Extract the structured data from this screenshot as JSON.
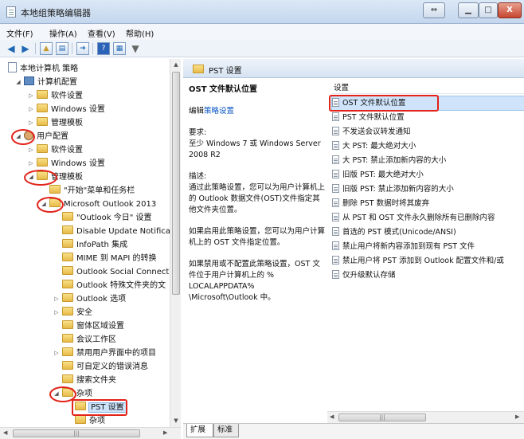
{
  "window": {
    "title": "本地组策略编辑器",
    "controls": {
      "restore": "⇔",
      "minimize": "▁",
      "maximize": "□",
      "close": "X"
    }
  },
  "menu": {
    "items": [
      "文件(F)",
      "操作(A)",
      "查看(V)",
      "帮助(H)"
    ]
  },
  "toolbar": {
    "buttons": [
      "back-icon",
      "forward-icon",
      "folder-up-icon",
      "show-hide-tree-icon",
      "export-icon",
      "help-icon",
      "view-icon",
      "filter-icon"
    ]
  },
  "tree": {
    "root": "本地计算机 策略",
    "computer_config": "计算机配置",
    "software_settings_1": "软件设置",
    "windows_settings_1": "Windows 设置",
    "admin_templates_1": "管理模板",
    "user_config": "用户配置",
    "software_settings_2": "软件设置",
    "windows_settings_2": "Windows 设置",
    "admin_templates_2": "管理模板",
    "start_menu": "\"开始\"菜单和任务栏",
    "outlook_2013": "Microsoft Outlook 2013",
    "outlook_today": "\"Outlook 今日\" 设置",
    "disable_update": "Disable Update Notifica",
    "infopath": "InfoPath 集成",
    "mime": "MIME 到 MAPI 的转换",
    "social_connect": "Outlook Social Connect",
    "special_folders": "Outlook 特殊文件夹的文",
    "outlook_options": "Outlook 选项",
    "security": "安全",
    "form_regions": "窗体区域设置",
    "meeting_workspace": "会议工作区",
    "disable_ui": "禁用用户界面中的项目",
    "custom_errors": "可自定义的错误消息",
    "search_folders": "搜索文件夹",
    "misc": "杂项",
    "pst_settings": "PST 设置",
    "misc_sub": "杂项"
  },
  "right": {
    "header": "PST 设置",
    "desc": {
      "title": "OST 文件默认位置",
      "edit_prefix": "编辑",
      "edit_link": "策略设置",
      "req_label": "要求:",
      "req_text": "至少 Windows 7 或 Windows Server 2008 R2",
      "desc_label": "描述:",
      "desc_text": "通过此策略设置，您可以为用户计算机上的 Outlook 数据文件(OST)文件指定其他文件夹位置。",
      "enabled_text": "如果启用此策略设置，您可以为用户计算机上的 OST 文件指定位置。",
      "disabled_text": "如果禁用或不配置此策略设置，OST 文件位于用户计算机上的 % LOCALAPPDATA% \\Microsoft\\Outlook 中。"
    },
    "column_header": "设置",
    "settings": [
      "OST 文件默认位置",
      "PST 文件默认位置",
      "不发送会议转发通知",
      "大 PST: 最大绝对大小",
      "大 PST: 禁止添加新内容的大小",
      "旧版 PST: 最大绝对大小",
      "旧版 PST: 禁止添加新内容的大小",
      "删除 PST 数据时将其废弃",
      "从 PST 和 OST 文件永久删除所有已删除内容",
      "首选的 PST 模式(Unicode/ANSI)",
      "禁止用户将新内容添加到现有 PST 文件",
      "禁止用户将 PST 添加到 Outlook 配置文件和/或",
      "仅升级默认存储"
    ],
    "tabs": [
      "扩展",
      "标准"
    ]
  },
  "colors": {
    "highlight": "#e2231a",
    "selection": "#cfe4fb",
    "link": "#0b57c6"
  }
}
